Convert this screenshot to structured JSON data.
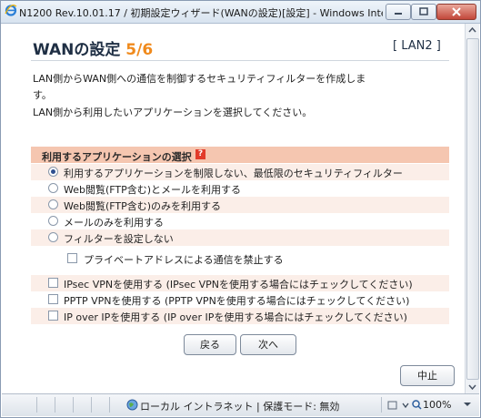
{
  "window": {
    "title": "N1200 Rev.10.01.17 / 初期設定ウィザード(WANの設定)[設定] - Windows Internet Exp..."
  },
  "page": {
    "heading": "WANの設定",
    "step": "5/6",
    "lan_tag": "[ LAN2 ]",
    "desc_line1": "LAN側からWAN側への通信を制御するセキュリティフィルターを作成しま",
    "desc_line2": "す。",
    "desc_line3": "LAN側から利用したいアプリケーションを選択してください。"
  },
  "section": {
    "title": "利用するアプリケーションの選択",
    "help_icon": "?"
  },
  "radios": [
    {
      "label": "利用するアプリケーションを制限しない、最低限のセキュリティフィルター",
      "checked": true
    },
    {
      "label": "Web閲覧(FTP含む)とメールを利用する",
      "checked": false
    },
    {
      "label": "Web閲覧(FTP含む)のみを利用する",
      "checked": false
    },
    {
      "label": "メールのみを利用する",
      "checked": false
    },
    {
      "label": "フィルターを設定しない",
      "checked": false
    }
  ],
  "private_check": {
    "label": "プライベートアドレスによる通信を禁止する",
    "checked": false
  },
  "checkboxes": [
    {
      "label": "IPsec VPNを使用する (IPsec VPNを使用する場合にはチェックしてください)",
      "checked": false
    },
    {
      "label": "PPTP VPNを使用する (PPTP VPNを使用する場合にはチェックしてください)",
      "checked": false
    },
    {
      "label": "IP over IPを使用する (IP over IPを使用する場合にはチェックしてください)",
      "checked": false
    }
  ],
  "buttons": {
    "back": "戻る",
    "next": "次へ",
    "stop": "中止"
  },
  "statusbar": {
    "zone": "ローカル イントラネット | 保護モード: 無効",
    "zoom": "100%"
  },
  "colors": {
    "step_accent": "#f08a1c",
    "section_bg": "#f5c6b0",
    "help_icon": "#e23b2a"
  }
}
